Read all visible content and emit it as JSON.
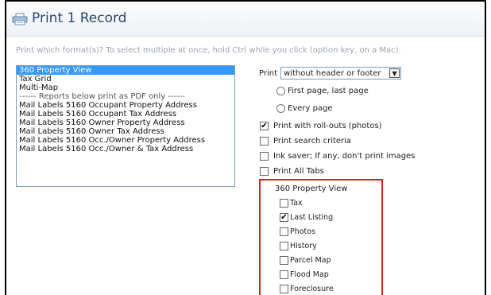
{
  "dialog": {
    "title": "Print 1 Record",
    "instructions": "Print which format(s)? To select multiple at once, hold Ctrl while you click (option key, on a Mac)."
  },
  "formats": {
    "options": [
      {
        "label": "360 Property View",
        "selected": true
      },
      {
        "label": "Tax Grid",
        "selected": false
      },
      {
        "label": "Multi-Map",
        "selected": false
      },
      {
        "label": "------ Reports below print as PDF only ------",
        "selected": false
      },
      {
        "label": "Mail Labels 5160 Occupant Property Address",
        "selected": false
      },
      {
        "label": "Mail Labels 5160 Occupant Tax Address",
        "selected": false
      },
      {
        "label": "Mail Labels 5160 Owner Property Address",
        "selected": false
      },
      {
        "label": "Mail Labels 5160 Owner Tax Address",
        "selected": false
      },
      {
        "label": "Mail Labels 5160 Occ./Owner Property Address",
        "selected": false
      },
      {
        "label": "Mail Labels 5160 Occ./Owner & Tax Address",
        "selected": false
      }
    ]
  },
  "print_options": {
    "print_label": "Print",
    "header_select_value": "without header or footer",
    "radio_first_last": "First page, last page",
    "radio_every_page": "Every page",
    "rollouts": {
      "label": "Print with roll-outs (photos)",
      "checked": true
    },
    "search_criteria": {
      "label": "Print search criteria",
      "checked": false
    },
    "ink_saver": {
      "label": "Ink saver; If any, don't print images",
      "checked": false
    },
    "all_tabs": {
      "label": "Print All Tabs",
      "checked": false
    }
  },
  "tabs_section": {
    "title": "360 Property View",
    "items": [
      {
        "label": "Tax",
        "checked": false
      },
      {
        "label": "Last Listing",
        "checked": true
      },
      {
        "label": "Photos",
        "checked": false
      },
      {
        "label": "History",
        "checked": false
      },
      {
        "label": "Parcel Map",
        "checked": false
      },
      {
        "label": "Flood Map",
        "checked": false
      },
      {
        "label": "Foreclosure",
        "checked": false
      }
    ]
  }
}
